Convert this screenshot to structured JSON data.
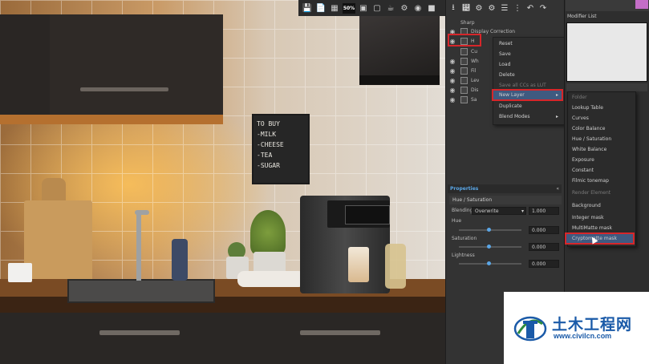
{
  "viewport": {
    "zoom_badge": "50%",
    "chalkboard": "TO BUY\n-MILK\n-CHEESE\n-TEA\n-SUGAR"
  },
  "cc_panel": {
    "layers": [
      {
        "label": "Sharp"
      },
      {
        "label": "Display Correction"
      },
      {
        "label": "H"
      },
      {
        "label": "Cu"
      },
      {
        "label": "Wh"
      },
      {
        "label": "Fil"
      },
      {
        "label": "Lev"
      },
      {
        "label": "Dis"
      },
      {
        "label": "Sa"
      }
    ],
    "context_menu": [
      {
        "label": "Reset",
        "disabled": false
      },
      {
        "label": "Save",
        "disabled": false
      },
      {
        "label": "Load",
        "disabled": false
      },
      {
        "label": "Delete",
        "disabled": false
      },
      {
        "label": "Save all CCs as LUT",
        "disabled": true
      },
      {
        "label": "New Layer",
        "disabled": false,
        "submenu": true
      },
      {
        "label": "Duplicate",
        "disabled": false
      },
      {
        "label": "Blend Modes",
        "disabled": false,
        "submenu": true
      }
    ],
    "properties": {
      "title": "Properties",
      "layer_name": "Hue / Saturation",
      "blending_label": "Blending",
      "blending_value": "Overwrite",
      "blending_amount": "1.000",
      "hue_label": "Hue",
      "hue_value": "0.000",
      "saturation_label": "Saturation",
      "saturation_value": "0.000",
      "lightness_label": "Lightness",
      "lightness_value": "0.000"
    }
  },
  "modifier_panel": {
    "label": "Modifier List",
    "submenu": [
      {
        "label": "Folder",
        "disabled": true
      },
      {
        "label": "Lookup Table",
        "disabled": false
      },
      {
        "label": "Curves",
        "disabled": false
      },
      {
        "label": "Color Balance",
        "disabled": false
      },
      {
        "label": "Hue / Saturation",
        "disabled": false
      },
      {
        "label": "White Balance",
        "disabled": false
      },
      {
        "label": "Exposure",
        "disabled": false
      },
      {
        "label": "Constant",
        "disabled": false
      },
      {
        "label": "Filmic tonemap",
        "disabled": false
      },
      {
        "label": "Render Element",
        "disabled": true
      },
      {
        "label": "Background",
        "disabled": false
      },
      {
        "label": "Integer mask",
        "disabled": false
      },
      {
        "label": "MultiMatte mask",
        "disabled": false
      },
      {
        "label": "Cryptomatte mask",
        "disabled": false
      }
    ]
  },
  "watermark": {
    "name_cn": "土木工程网",
    "url": "www.civilcn.com"
  },
  "colors": {
    "highlight_red": "#d6262a",
    "accent_blue": "#5aa6e6",
    "watermark_blue": "#1a5aa8"
  }
}
